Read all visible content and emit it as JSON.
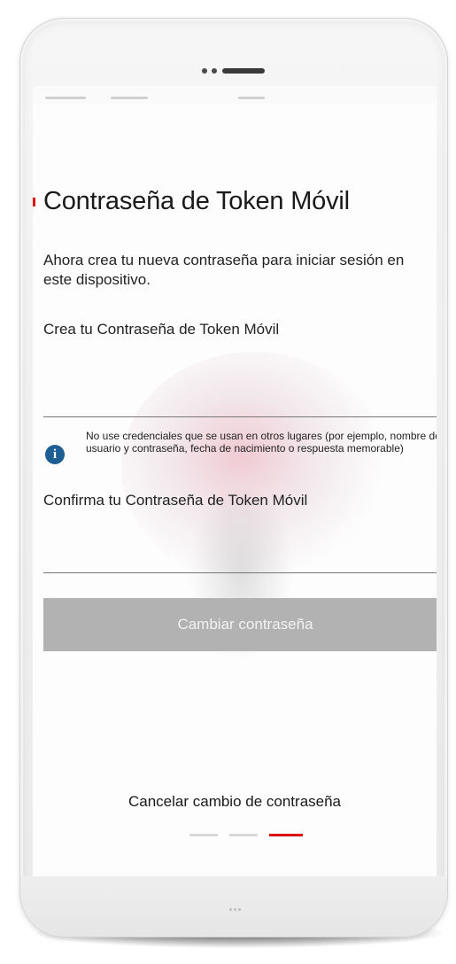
{
  "screen": {
    "title": "Contraseña de Token Móvil",
    "intro": "Ahora crea tu nueva contraseña para iniciar sesión en este dispositivo.",
    "field_create_label": "Crea tu Contraseña de Token Móvil",
    "info_icon": "info-icon",
    "info_text": "No use credenciales que se usan en otros lugares (por ejemplo, nombre de usuario y contraseña, fecha de nacimiento o respuesta memorable)",
    "field_confirm_label": "Confirma tu Contraseña de Token Móvil",
    "primary_button_label": "Cambiar contraseña",
    "cancel_label": "Cancelar cambio de contraseña",
    "pager": {
      "total_steps": 3,
      "active_step": 3
    }
  },
  "colors": {
    "accent": "#db0011",
    "info_icon": "#1d5e94",
    "button_disabled": "#b2b2b2"
  }
}
